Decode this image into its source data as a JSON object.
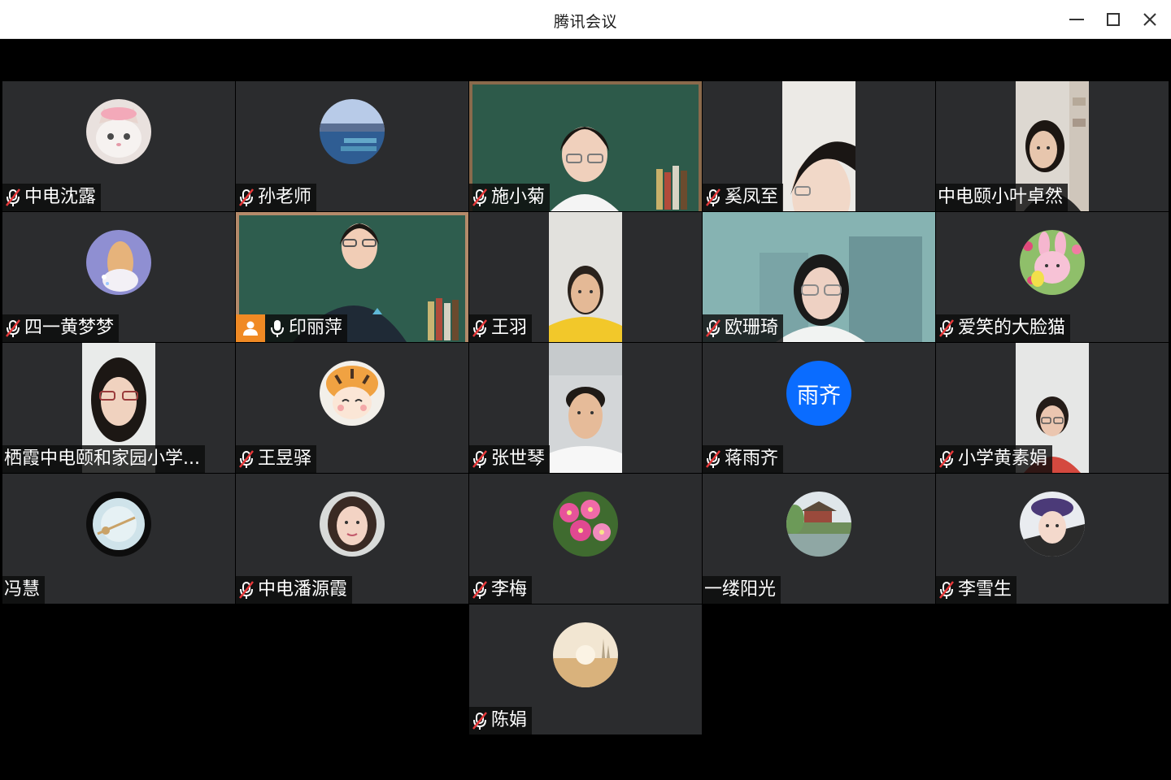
{
  "window": {
    "title": "腾讯会议",
    "controls": [
      "minimize",
      "maximize",
      "close"
    ]
  },
  "tiles": [
    {
      "name": "中电沈露",
      "mic": "muted",
      "kind": "avatar",
      "avatar": "cat"
    },
    {
      "name": "孙老师",
      "mic": "muted",
      "kind": "avatar",
      "avatar": "lake"
    },
    {
      "name": "施小菊",
      "mic": "muted",
      "kind": "video",
      "scene": "chalkboard-woman"
    },
    {
      "name": "奚凤至",
      "mic": "muted",
      "kind": "portrait",
      "scene": "close-face"
    },
    {
      "name": "中电颐小叶卓然",
      "mic": "none",
      "kind": "portrait",
      "scene": "room-woman"
    },
    {
      "name": "四一黄梦梦",
      "mic": "muted",
      "kind": "avatar",
      "avatar": "illustration"
    },
    {
      "name": "印丽萍",
      "mic": "on",
      "host": true,
      "kind": "video",
      "scene": "chalkboard-teacher"
    },
    {
      "name": "王羽",
      "mic": "muted",
      "kind": "portrait",
      "scene": "yellow-shirt"
    },
    {
      "name": "欧珊琦",
      "mic": "muted",
      "kind": "video",
      "scene": "teal-room"
    },
    {
      "name": "爱笑的大脸猫",
      "mic": "muted",
      "kind": "avatar",
      "avatar": "bunny"
    },
    {
      "name": "栖霞中电颐和家园小学...",
      "mic": "none",
      "kind": "portrait",
      "scene": "glasses-woman"
    },
    {
      "name": "王昱驿",
      "mic": "muted",
      "kind": "avatar",
      "avatar": "tiger"
    },
    {
      "name": "张世琴",
      "mic": "muted",
      "kind": "portrait",
      "scene": "white-shirt"
    },
    {
      "name": "蒋雨齐",
      "mic": "muted",
      "kind": "avatar",
      "avatar": "text",
      "avatar_text": "雨齐",
      "avatar_color": "#0a6cff"
    },
    {
      "name": "小学黄素娟",
      "mic": "muted",
      "kind": "portrait",
      "scene": "small-woman"
    },
    {
      "name": "冯慧",
      "mic": "none",
      "kind": "avatar",
      "avatar": "dandelion"
    },
    {
      "name": "中电潘源霞",
      "mic": "muted",
      "kind": "avatar",
      "avatar": "woman"
    },
    {
      "name": "李梅",
      "mic": "muted",
      "kind": "avatar",
      "avatar": "flowers"
    },
    {
      "name": "一缕阳光",
      "mic": "none",
      "kind": "avatar",
      "avatar": "park"
    },
    {
      "name": "李雪生",
      "mic": "muted",
      "kind": "avatar",
      "avatar": "girl"
    },
    {
      "name": "陈娟",
      "mic": "muted",
      "kind": "avatar",
      "avatar": "sunrise"
    }
  ]
}
